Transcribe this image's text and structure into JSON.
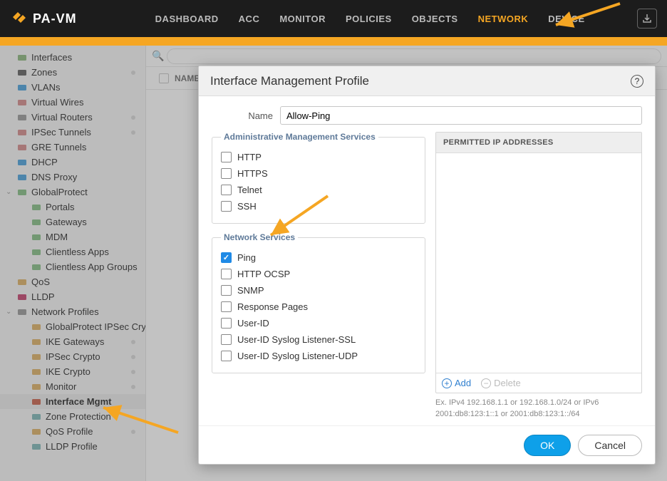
{
  "logo": "PA-VM",
  "tabs": [
    "DASHBOARD",
    "ACC",
    "MONITOR",
    "POLICIES",
    "OBJECTS",
    "NETWORK",
    "DEVICE"
  ],
  "active_tab": "NETWORK",
  "sidebar": {
    "items": [
      {
        "label": "Interfaces",
        "icon": "#7a6",
        "k": "interfaces"
      },
      {
        "label": "Zones",
        "icon": "#444",
        "k": "zones",
        "dot": true
      },
      {
        "label": "VLANs",
        "icon": "#2a90d6",
        "k": "vlans"
      },
      {
        "label": "Virtual Wires",
        "icon": "#c77",
        "k": "vwires"
      },
      {
        "label": "Virtual Routers",
        "icon": "#888",
        "k": "vrouters",
        "dot": true
      },
      {
        "label": "IPSec Tunnels",
        "icon": "#c77",
        "k": "ipsec",
        "dot": true
      },
      {
        "label": "GRE Tunnels",
        "icon": "#c77",
        "k": "gre"
      },
      {
        "label": "DHCP",
        "icon": "#2a90d6",
        "k": "dhcp"
      },
      {
        "label": "DNS Proxy",
        "icon": "#2a90d6",
        "k": "dnsproxy"
      },
      {
        "label": "GlobalProtect",
        "icon": "#6fb36f",
        "k": "gp",
        "children": [
          {
            "label": "Portals",
            "icon": "#6fb36f",
            "k": "portals"
          },
          {
            "label": "Gateways",
            "icon": "#6fb36f",
            "k": "gateways"
          },
          {
            "label": "MDM",
            "icon": "#6fb36f",
            "k": "mdm"
          },
          {
            "label": "Clientless Apps",
            "icon": "#6fb36f",
            "k": "clapps"
          },
          {
            "label": "Clientless App Groups",
            "icon": "#6fb36f",
            "k": "clappgroups"
          }
        ]
      },
      {
        "label": "QoS",
        "icon": "#d8a24a",
        "k": "qos"
      },
      {
        "label": "LLDP",
        "icon": "#b25",
        "k": "lldp"
      },
      {
        "label": "Network Profiles",
        "icon": "#888",
        "k": "netprof",
        "children": [
          {
            "label": "GlobalProtect IPSec Cry",
            "icon": "#d8a24a",
            "k": "gpipsec",
            "dot": true
          },
          {
            "label": "IKE Gateways",
            "icon": "#d8a24a",
            "k": "ikegw",
            "dot": true
          },
          {
            "label": "IPSec Crypto",
            "icon": "#d8a24a",
            "k": "ipseccrypto",
            "dot": true
          },
          {
            "label": "IKE Crypto",
            "icon": "#d8a24a",
            "k": "ikecrypto",
            "dot": true
          },
          {
            "label": "Monitor",
            "icon": "#d8a24a",
            "k": "monitor",
            "dot": true
          },
          {
            "label": "Interface Mgmt",
            "icon": "#c0452a",
            "k": "ifacemgmt",
            "active": true
          },
          {
            "label": "Zone Protection",
            "icon": "#6aa",
            "k": "zoneprot"
          },
          {
            "label": "QoS Profile",
            "icon": "#d8a24a",
            "k": "qosprof",
            "dot": true
          },
          {
            "label": "LLDP Profile",
            "icon": "#6aa",
            "k": "lldpprof"
          }
        ]
      }
    ]
  },
  "grid": {
    "col1": "NAME"
  },
  "modal": {
    "title": "Interface Management Profile",
    "name_label": "Name",
    "name_value": "Allow-Ping",
    "admin_legend": "Administrative Management Services",
    "admin_services": [
      {
        "label": "HTTP",
        "checked": false
      },
      {
        "label": "HTTPS",
        "checked": false
      },
      {
        "label": "Telnet",
        "checked": false
      },
      {
        "label": "SSH",
        "checked": false
      }
    ],
    "net_legend": "Network Services",
    "net_services": [
      {
        "label": "Ping",
        "checked": true
      },
      {
        "label": "HTTP OCSP",
        "checked": false
      },
      {
        "label": "SNMP",
        "checked": false
      },
      {
        "label": "Response Pages",
        "checked": false
      },
      {
        "label": "User-ID",
        "checked": false
      },
      {
        "label": "User-ID Syslog Listener-SSL",
        "checked": false
      },
      {
        "label": "User-ID Syslog Listener-UDP",
        "checked": false
      }
    ],
    "perm_header": "PERMITTED IP ADDRESSES",
    "add_label": "Add",
    "delete_label": "Delete",
    "hint1": "Ex. IPv4 192.168.1.1 or 192.168.1.0/24 or IPv6",
    "hint2": "2001:db8:123:1::1 or 2001:db8:123:1::/64",
    "ok": "OK",
    "cancel": "Cancel"
  }
}
